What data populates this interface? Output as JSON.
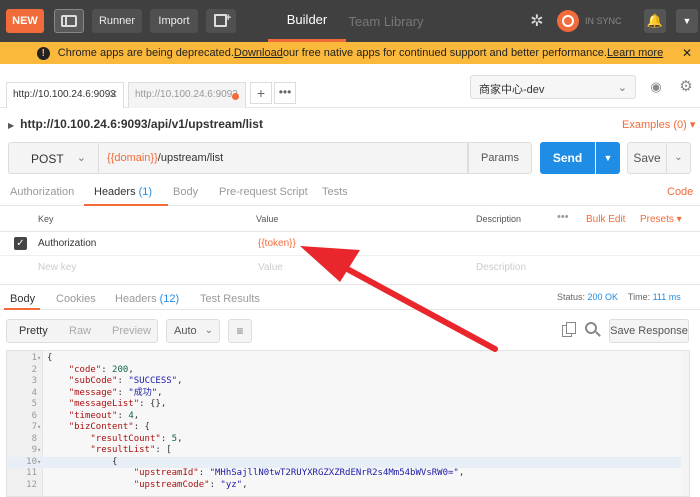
{
  "topbar": {
    "new_label": "NEW",
    "runner_label": "Runner",
    "import_label": "Import",
    "builder_tab": "Builder",
    "team_library_tab": "Team Library",
    "sync_label": "IN SYNC"
  },
  "banner": {
    "text_before": "Chrome apps are being deprecated. ",
    "download_link": "Download",
    "text_after": " our free native apps for continued support and better performance. ",
    "learn_more_link": "Learn more",
    "close": "✕"
  },
  "tabs": {
    "items": [
      {
        "label": "http://10.100.24.6:9093",
        "close": "✕"
      },
      {
        "label": "http://10.100.24.6:9093"
      }
    ],
    "plus": "+",
    "more": "•••"
  },
  "environment": {
    "selected": "商家中心-dev"
  },
  "request": {
    "title": "http://10.100.24.6:9093/api/v1/upstream/list",
    "examples_label": "Examples (0)",
    "method": "POST",
    "url_var": "{{domain}}",
    "url_path": "/upstream/list",
    "params_label": "Params",
    "send_label": "Send",
    "save_label": "Save"
  },
  "request_tabs": {
    "authorization": "Authorization",
    "headers": "Headers",
    "headers_count": "(1)",
    "body": "Body",
    "prerequest": "Pre-request Script",
    "tests": "Tests",
    "code": "Code"
  },
  "headers_table": {
    "col_key": "Key",
    "col_value": "Value",
    "col_description": "Description",
    "more": "•••",
    "bulk_edit": "Bulk Edit",
    "presets": "Presets ▾",
    "rows": [
      {
        "key": "Authorization",
        "value": "{{token}}",
        "checked": "✓"
      }
    ],
    "new_key_placeholder": "New key",
    "value_placeholder": "Value",
    "description_placeholder": "Description"
  },
  "response": {
    "tabs": {
      "body": "Body",
      "cookies": "Cookies",
      "headers": "Headers",
      "headers_count": "(12)",
      "test_results": "Test Results"
    },
    "status_label": "Status:",
    "status_value": "200 OK",
    "time_label": "Time:",
    "time_value": "111 ms",
    "format": {
      "pretty": "Pretty",
      "raw": "Raw",
      "preview": "Preview",
      "auto": "Auto",
      "save_response": "Save Response"
    }
  },
  "code_lines": [
    {
      "n": "1",
      "fold": "▾",
      "text": "{"
    },
    {
      "n": "2",
      "text": "    \"code\": 200,"
    },
    {
      "n": "3",
      "text": "    \"subCode\": \"SUCCESS\","
    },
    {
      "n": "4",
      "text": "    \"message\": \"成功\","
    },
    {
      "n": "5",
      "text": "    \"messageList\": {},"
    },
    {
      "n": "6",
      "text": "    \"timeout\": 4,"
    },
    {
      "n": "7",
      "fold": "▾",
      "text": "    \"bizContent\": {"
    },
    {
      "n": "8",
      "text": "        \"resultCount\": 5,"
    },
    {
      "n": "9",
      "fold": "▾",
      "text": "        \"resultList\": ["
    },
    {
      "n": "10",
      "fold": "▾",
      "text": "            {"
    },
    {
      "n": "11",
      "text": "                \"upstreamId\": \"MHhSajllN0twT2RUYXRGZXZRdENrR2s4Mm54bWVsRW0=\","
    },
    {
      "n": "12",
      "text": "                \"upstreamCode\": \"yz\","
    }
  ],
  "colors": {
    "accent": "#f26b3a",
    "send_blue": "#1f8ce5",
    "banner": "#fbb93c",
    "arrow_red": "#e8262b"
  }
}
